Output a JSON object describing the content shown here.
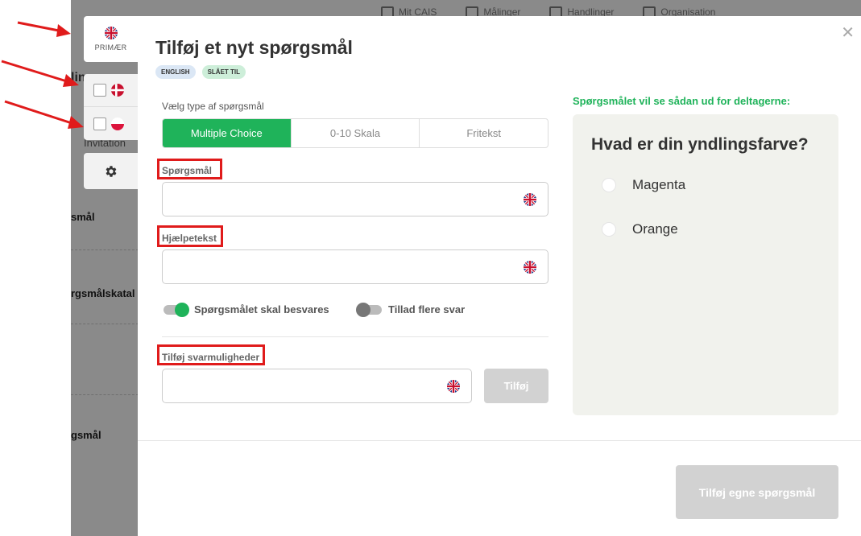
{
  "background": {
    "nav": [
      "Mit CAIS",
      "Målinger",
      "Handlinger",
      "Organisation"
    ],
    "fragments": [
      "lin",
      "Invitation",
      "smål",
      "rgsmålskatal",
      "gsmål"
    ]
  },
  "languages": {
    "primary_label": "PRIMÆR",
    "primary_flag": "uk-flag-icon",
    "others": [
      {
        "flag": "denmark-flag-icon",
        "checked": false
      },
      {
        "flag": "poland-flag-icon",
        "checked": false
      }
    ]
  },
  "modal": {
    "title": "Tilføj et nyt spørgsmål",
    "badges": [
      "ENGLISH",
      "SLÅET TIL"
    ],
    "type_label": "Vælg type af spørgsmål",
    "types": [
      "Multiple Choice",
      "0-10 Skala",
      "Fritekst"
    ],
    "selected_type": "Multiple Choice",
    "question_label": "Spørgsmål",
    "question_value": "",
    "help_label": "Hjælpetekst",
    "help_value": "",
    "toggle_required": "Spørgsmålet skal besvares",
    "toggle_required_on": true,
    "toggle_multiple": "Tillad flere svar",
    "toggle_multiple_on": false,
    "options_label": "Tilføj svarmuligheder",
    "options_value": "",
    "add_button": "Tilføj",
    "preview_label": "Spørgsmålet vil se sådan ud for deltagerne:",
    "preview_question": "Hvad er din yndlingsfarve?",
    "preview_options": [
      "Magenta",
      "Orange"
    ],
    "submit_button": "Tilføj egne spørgsmål",
    "close_icon": "close-icon"
  },
  "colors": {
    "accent": "#1fb35a",
    "highlight": "#e01b1b",
    "disabled": "#d2d2d2",
    "overlay": "#8a8a8a"
  }
}
